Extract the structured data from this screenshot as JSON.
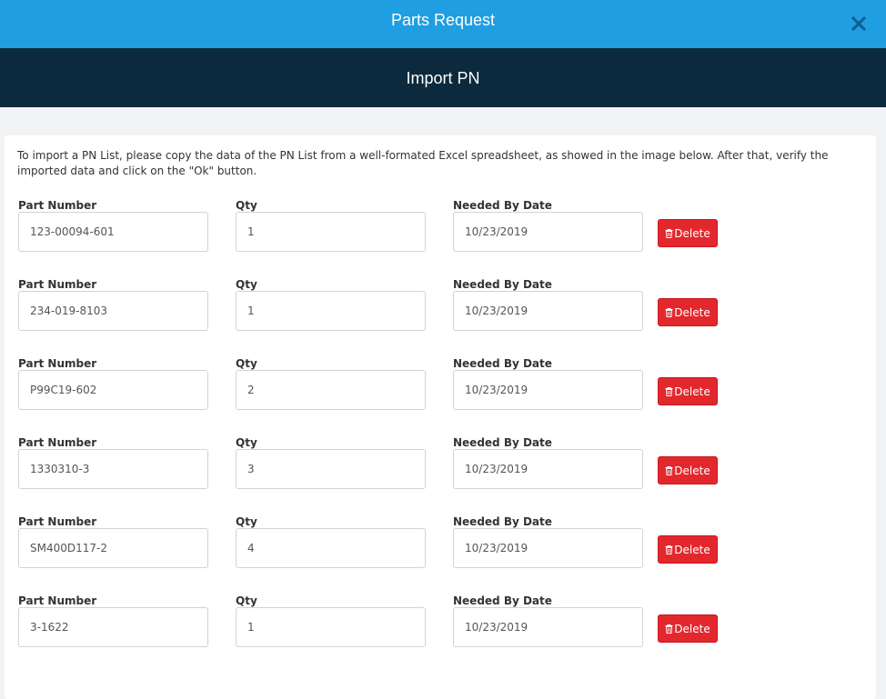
{
  "header": {
    "title": "Parts Request",
    "close_label": "×"
  },
  "subheader": {
    "title": "Import PN"
  },
  "instructions": "To import a PN List, please copy the data of the PN List from a well-formated Excel spreadsheet, as showed in the image below. After that, verify the imported data and click on the \"Ok\" button.",
  "labels": {
    "part_number": "Part Number",
    "qty": "Qty",
    "needed_by_date": "Needed By Date",
    "delete": "Delete"
  },
  "rows": [
    {
      "part_number": "123-00094-601",
      "qty": "1",
      "needed_by_date": "10/23/2019"
    },
    {
      "part_number": "234-019-8103",
      "qty": "1",
      "needed_by_date": "10/23/2019"
    },
    {
      "part_number": "P99C19-602",
      "qty": "2",
      "needed_by_date": "10/23/2019"
    },
    {
      "part_number": "1330310-3",
      "qty": "3",
      "needed_by_date": "10/23/2019"
    },
    {
      "part_number": "SM400D117-2",
      "qty": "4",
      "needed_by_date": "10/23/2019"
    },
    {
      "part_number": "3-1622",
      "qty": "1",
      "needed_by_date": "10/23/2019"
    }
  ],
  "colors": {
    "header_bg": "#1f9ee2",
    "subheader_bg": "#0c2a3d",
    "delete_bg": "#e3282d"
  },
  "icons": {
    "close": "close-icon",
    "delete": "trash-icon"
  }
}
